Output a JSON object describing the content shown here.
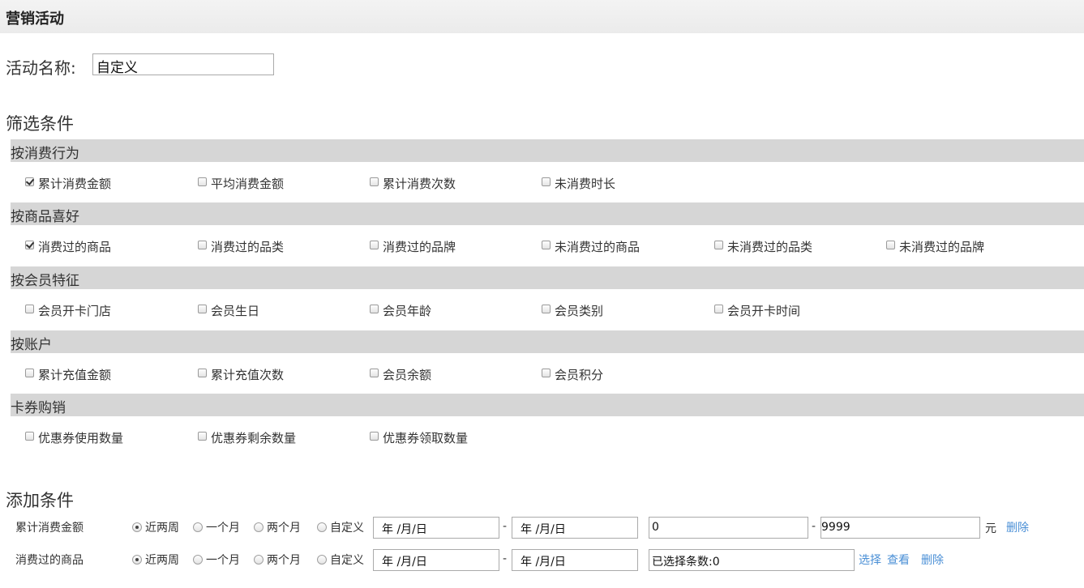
{
  "page": {
    "title": "营销活动"
  },
  "activity": {
    "label": "活动名称:",
    "value": "自定义"
  },
  "filter": {
    "title": "筛选条件",
    "groups": [
      {
        "title": "按消费行为",
        "items": [
          {
            "label": "累计消费金额",
            "checked": true
          },
          {
            "label": "平均消费金额",
            "checked": false
          },
          {
            "label": "累计消费次数",
            "checked": false
          },
          {
            "label": "未消费时长",
            "checked": false
          }
        ]
      },
      {
        "title": "按商品喜好",
        "items": [
          {
            "label": "消费过的商品",
            "checked": true
          },
          {
            "label": "消费过的品类",
            "checked": false
          },
          {
            "label": "消费过的品牌",
            "checked": false
          },
          {
            "label": "未消费过的商品",
            "checked": false
          },
          {
            "label": "未消费过的品类",
            "checked": false
          },
          {
            "label": "未消费过的品牌",
            "checked": false
          }
        ]
      },
      {
        "title": "按会员特征",
        "items": [
          {
            "label": "会员开卡门店",
            "checked": false
          },
          {
            "label": "会员生日",
            "checked": false
          },
          {
            "label": "会员年龄",
            "checked": false
          },
          {
            "label": "会员类别",
            "checked": false
          },
          {
            "label": "会员开卡时间",
            "checked": false
          }
        ]
      },
      {
        "title": "按账户",
        "items": [
          {
            "label": "累计充值金额",
            "checked": false
          },
          {
            "label": "累计充值次数",
            "checked": false
          },
          {
            "label": "会员余额",
            "checked": false
          },
          {
            "label": "会员积分",
            "checked": false
          }
        ]
      },
      {
        "title": "卡券购销",
        "items": [
          {
            "label": "优惠券使用数量",
            "checked": false
          },
          {
            "label": "优惠券剩余数量",
            "checked": false
          },
          {
            "label": "优惠券领取数量",
            "checked": false
          }
        ]
      }
    ]
  },
  "add": {
    "title": "添加条件",
    "time_options": [
      "近两周",
      "一个月",
      "两个月",
      "自定义"
    ],
    "date_placeholder": "年 /月/日",
    "dash": "-",
    "rows": [
      {
        "label": "累计消费金额",
        "selected": 0,
        "date_from": "年 /月/日",
        "date_to": "年 /月/日",
        "min": "0",
        "max": "9999",
        "unit": "元",
        "delete": "删除"
      },
      {
        "label": "消费过的商品",
        "selected": 0,
        "date_from": "年 /月/日",
        "date_to": "年 /月/日",
        "selected_count": "已选择条数:0",
        "choose": "选择",
        "view": "查看",
        "delete": "删除"
      }
    ]
  }
}
